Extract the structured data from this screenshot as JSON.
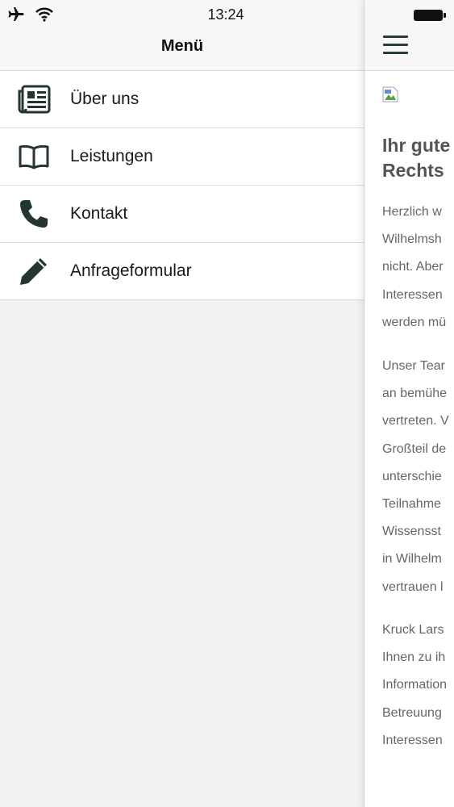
{
  "status": {
    "time": "13:24",
    "icons": [
      "airplane-icon",
      "wifi-icon",
      "battery-icon"
    ]
  },
  "menu": {
    "title": "Menü",
    "items": [
      {
        "label": "Über uns",
        "icon": "newspaper-icon"
      },
      {
        "label": "Leistungen",
        "icon": "book-icon"
      },
      {
        "label": "Kontakt",
        "icon": "phone-icon"
      },
      {
        "label": "Anfrageformular",
        "icon": "pencil-icon"
      }
    ]
  },
  "content": {
    "title_lines": [
      "Ihr gute",
      "Rechts"
    ],
    "paragraphs": [
      [
        "Herzlich w",
        "Wilhelmsh",
        "nicht. Aber",
        "Interessen",
        "werden mü"
      ],
      [
        "Unser Tear",
        "an bemühe",
        "vertreten. V",
        "Großteil de",
        "unterschie",
        "Teilnahme",
        "Wissensst",
        "in Wilhelm",
        "vertrauen l"
      ],
      [
        "Kruck Lars",
        "Ihnen zu ih",
        "Information",
        "Betreuung",
        "Interessen"
      ]
    ]
  },
  "colors": {
    "icon": "#23372d",
    "menu_bg": "#f2f2f2",
    "header_bg": "#f7f7f7"
  }
}
